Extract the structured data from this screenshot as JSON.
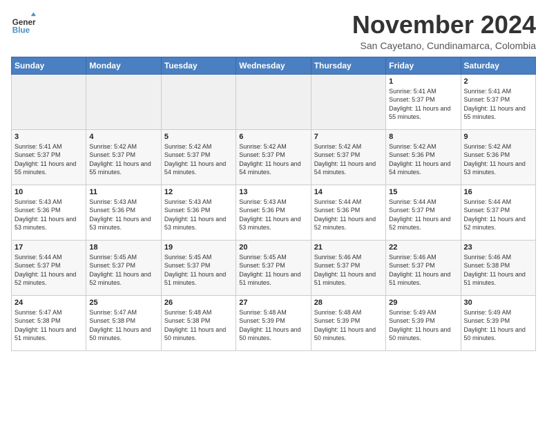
{
  "header": {
    "logo_line1": "General",
    "logo_line2": "Blue",
    "month_year": "November 2024",
    "location": "San Cayetano, Cundinamarca, Colombia"
  },
  "days_of_week": [
    "Sunday",
    "Monday",
    "Tuesday",
    "Wednesday",
    "Thursday",
    "Friday",
    "Saturday"
  ],
  "weeks": [
    [
      {
        "day": "",
        "empty": true
      },
      {
        "day": "",
        "empty": true
      },
      {
        "day": "",
        "empty": true
      },
      {
        "day": "",
        "empty": true
      },
      {
        "day": "",
        "empty": true
      },
      {
        "day": "1",
        "sunrise": "5:41 AM",
        "sunset": "5:37 PM",
        "daylight": "11 hours and 55 minutes."
      },
      {
        "day": "2",
        "sunrise": "5:41 AM",
        "sunset": "5:37 PM",
        "daylight": "11 hours and 55 minutes."
      }
    ],
    [
      {
        "day": "3",
        "sunrise": "5:41 AM",
        "sunset": "5:37 PM",
        "daylight": "11 hours and 55 minutes."
      },
      {
        "day": "4",
        "sunrise": "5:42 AM",
        "sunset": "5:37 PM",
        "daylight": "11 hours and 55 minutes."
      },
      {
        "day": "5",
        "sunrise": "5:42 AM",
        "sunset": "5:37 PM",
        "daylight": "11 hours and 54 minutes."
      },
      {
        "day": "6",
        "sunrise": "5:42 AM",
        "sunset": "5:37 PM",
        "daylight": "11 hours and 54 minutes."
      },
      {
        "day": "7",
        "sunrise": "5:42 AM",
        "sunset": "5:37 PM",
        "daylight": "11 hours and 54 minutes."
      },
      {
        "day": "8",
        "sunrise": "5:42 AM",
        "sunset": "5:36 PM",
        "daylight": "11 hours and 54 minutes."
      },
      {
        "day": "9",
        "sunrise": "5:42 AM",
        "sunset": "5:36 PM",
        "daylight": "11 hours and 53 minutes."
      }
    ],
    [
      {
        "day": "10",
        "sunrise": "5:43 AM",
        "sunset": "5:36 PM",
        "daylight": "11 hours and 53 minutes."
      },
      {
        "day": "11",
        "sunrise": "5:43 AM",
        "sunset": "5:36 PM",
        "daylight": "11 hours and 53 minutes."
      },
      {
        "day": "12",
        "sunrise": "5:43 AM",
        "sunset": "5:36 PM",
        "daylight": "11 hours and 53 minutes."
      },
      {
        "day": "13",
        "sunrise": "5:43 AM",
        "sunset": "5:36 PM",
        "daylight": "11 hours and 53 minutes."
      },
      {
        "day": "14",
        "sunrise": "5:44 AM",
        "sunset": "5:36 PM",
        "daylight": "11 hours and 52 minutes."
      },
      {
        "day": "15",
        "sunrise": "5:44 AM",
        "sunset": "5:37 PM",
        "daylight": "11 hours and 52 minutes."
      },
      {
        "day": "16",
        "sunrise": "5:44 AM",
        "sunset": "5:37 PM",
        "daylight": "11 hours and 52 minutes."
      }
    ],
    [
      {
        "day": "17",
        "sunrise": "5:44 AM",
        "sunset": "5:37 PM",
        "daylight": "11 hours and 52 minutes."
      },
      {
        "day": "18",
        "sunrise": "5:45 AM",
        "sunset": "5:37 PM",
        "daylight": "11 hours and 52 minutes."
      },
      {
        "day": "19",
        "sunrise": "5:45 AM",
        "sunset": "5:37 PM",
        "daylight": "11 hours and 51 minutes."
      },
      {
        "day": "20",
        "sunrise": "5:45 AM",
        "sunset": "5:37 PM",
        "daylight": "11 hours and 51 minutes."
      },
      {
        "day": "21",
        "sunrise": "5:46 AM",
        "sunset": "5:37 PM",
        "daylight": "11 hours and 51 minutes."
      },
      {
        "day": "22",
        "sunrise": "5:46 AM",
        "sunset": "5:37 PM",
        "daylight": "11 hours and 51 minutes."
      },
      {
        "day": "23",
        "sunrise": "5:46 AM",
        "sunset": "5:38 PM",
        "daylight": "11 hours and 51 minutes."
      }
    ],
    [
      {
        "day": "24",
        "sunrise": "5:47 AM",
        "sunset": "5:38 PM",
        "daylight": "11 hours and 51 minutes."
      },
      {
        "day": "25",
        "sunrise": "5:47 AM",
        "sunset": "5:38 PM",
        "daylight": "11 hours and 50 minutes."
      },
      {
        "day": "26",
        "sunrise": "5:48 AM",
        "sunset": "5:38 PM",
        "daylight": "11 hours and 50 minutes."
      },
      {
        "day": "27",
        "sunrise": "5:48 AM",
        "sunset": "5:39 PM",
        "daylight": "11 hours and 50 minutes."
      },
      {
        "day": "28",
        "sunrise": "5:48 AM",
        "sunset": "5:39 PM",
        "daylight": "11 hours and 50 minutes."
      },
      {
        "day": "29",
        "sunrise": "5:49 AM",
        "sunset": "5:39 PM",
        "daylight": "11 hours and 50 minutes."
      },
      {
        "day": "30",
        "sunrise": "5:49 AM",
        "sunset": "5:39 PM",
        "daylight": "11 hours and 50 minutes."
      }
    ]
  ]
}
